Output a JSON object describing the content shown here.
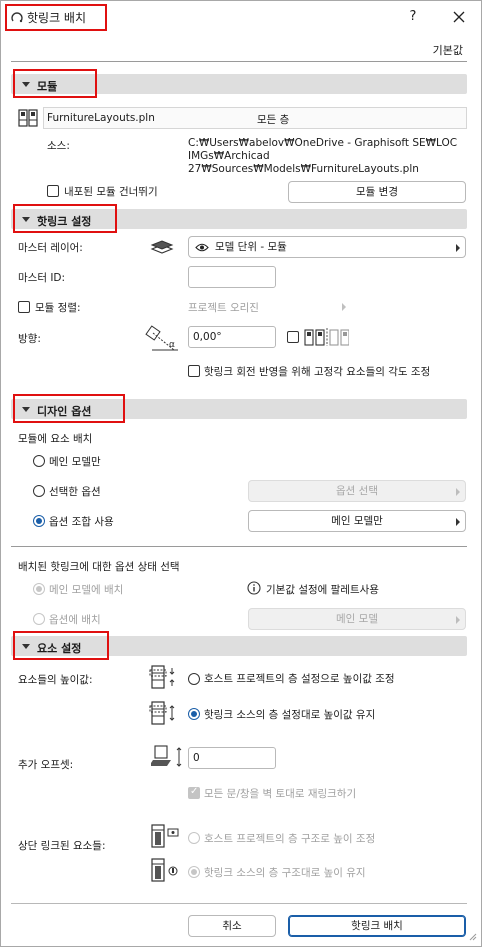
{
  "window": {
    "title": "핫링크 배치",
    "help": "?",
    "default_link": "기본값"
  },
  "module_section": {
    "title": "모듈",
    "file_name": "FurnitureLayouts.pln",
    "stories": "모든 층",
    "source_label": "소스:",
    "source_path_1": "C:₩Users₩abelov₩OneDrive - Graphisoft SE₩LOC",
    "source_path_2": "IMGs₩Archicad",
    "source_path_3": "27₩Sources₩Models₩FurnitureLayouts.pln",
    "skip_nested_label": "내포된 모듈 건너뛰기",
    "change_module_button": "모듈 변경"
  },
  "hotlink_settings": {
    "title": "핫링크 설정",
    "master_layer_label": "마스터 레이어:",
    "master_layer_value": "모델 단위 - 모듈",
    "master_id_label": "마스터 ID:",
    "master_id_value": "",
    "align_module_label": "모듈 정렬:",
    "align_module_value": "프로젝트 오리진",
    "orientation_label": "방향:",
    "orientation_value": "0,00°",
    "adjust_angle_label": "핫링크 회전 반영을 위해 고정각 요소들의 각도 조정"
  },
  "design_options": {
    "title": "디자인 옵션",
    "place_elements_label": "모듈에 요소 배치",
    "main_model_only": "메인 모델만",
    "selected_option": "선택한 옵션",
    "select_option_button": "옵션 선택",
    "use_combination": "옵션 조합 사용",
    "combination_value": "메인 모델만",
    "status_label": "배치된 핫링크에 대한 옵션 상태 선택",
    "place_in_main": "메인 모델에 배치",
    "palette_default": "기본값 설정에 팔레트사용",
    "place_in_option": "옵션에 배치",
    "main_model_button": "메인 모델"
  },
  "element_settings": {
    "title": "요소 설정",
    "height_label": "요소들의 높이값:",
    "height_option_1": "호스트 프로젝트의 층 설정으로 높이값 조정",
    "height_option_2": "핫링크 소스의 층 설정대로 높이값 유지",
    "offset_label": "추가 오프셋:",
    "offset_value": "0",
    "relink_doors_label": "모든 문/창을 벽 토대로 재링크하기",
    "top_linked_label": "상단 링크된 요소들:",
    "top_option_1": "호스트 프로젝트의 층 구조로 높이 조정",
    "top_option_2": "핫링크 소스의 층 구조대로 높이 유지"
  },
  "footer": {
    "cancel_button": "취소",
    "place_button": "핫링크 배치"
  },
  "colors": {
    "accent": "#1a5ea8",
    "highlight_box": "#e01010",
    "section_bar": "#dedede"
  }
}
